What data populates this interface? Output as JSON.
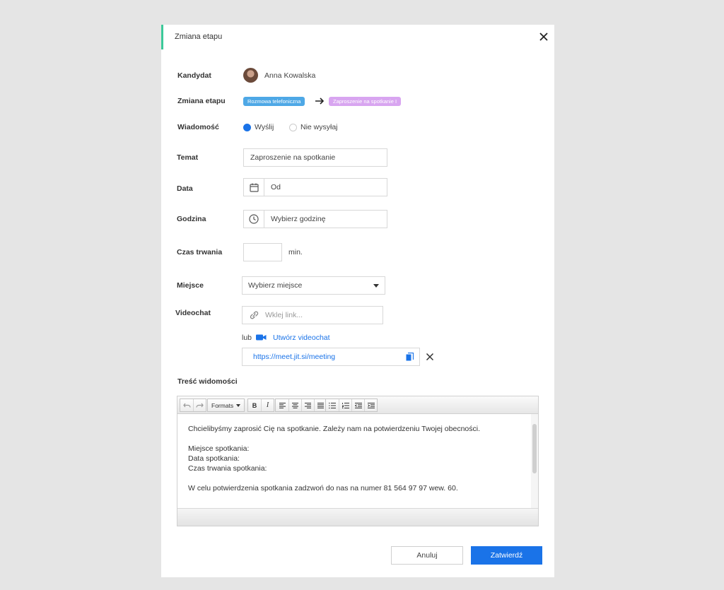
{
  "header": {
    "title": "Zmiana etapu"
  },
  "candidate": {
    "label": "Kandydat",
    "name": "Anna Kowalska"
  },
  "stage": {
    "label": "Zmiana etapu",
    "from": "Rozmowa telefoniczna",
    "to": "Zaproszenie na spotkanie I"
  },
  "message": {
    "label": "Wiadomość",
    "send": "Wyślij",
    "dont_send": "Nie wysyłaj"
  },
  "subject": {
    "label": "Temat",
    "value": "Zaproszenie na spotkanie"
  },
  "date": {
    "label": "Data",
    "value": "Od"
  },
  "time": {
    "label": "Godzina",
    "placeholder": "Wybierz godzinę"
  },
  "duration": {
    "label": "Czas trwania",
    "unit": "min."
  },
  "place": {
    "label": "Miejsce",
    "value": "Wybierz miejsce"
  },
  "videochat": {
    "label": "Videochat",
    "placeholder": "Wklej link...",
    "or": "lub",
    "create": "Utwórz videochat",
    "url": "https://meet.jit.si/meeting"
  },
  "content": {
    "label": "Treść widomości",
    "toolbar": {
      "formats": "Formats",
      "bold": "B",
      "italic": "I"
    },
    "lines": [
      "Chcielibyśmy zaprosić Cię na spotkanie. Zależy nam na potwierdzeniu Twojej obecności.",
      "",
      "Miejsce spotkania:",
      "Data spotkania:",
      "Czas trwania spotkania:",
      "",
      "W celu potwierdzenia spotkania zadzwoń do nas na numer 81 564 97 97 wew. 60."
    ]
  },
  "actions": {
    "cancel": "Anuluj",
    "confirm": "Zatwierdź"
  },
  "colors": {
    "accent": "#1a73e8",
    "header_bar": "#3cc99a",
    "badge_from": "#4ea8e6",
    "badge_to": "#d8a5f0"
  }
}
